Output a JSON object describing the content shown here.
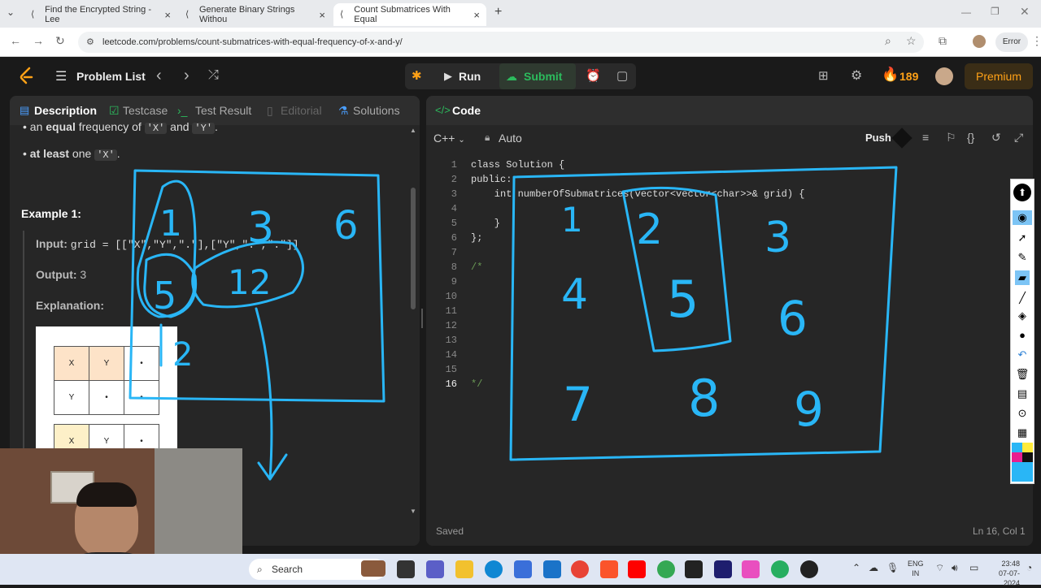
{
  "browser": {
    "tabs": [
      {
        "title": "Find the Encrypted String - Lee"
      },
      {
        "title": "Generate Binary Strings Withou"
      },
      {
        "title": "Count Submatrices With Equal"
      }
    ],
    "url": "leetcode.com/problems/count-submatrices-with-equal-frequency-of-x-and-y/",
    "error_label": "Error"
  },
  "nav": {
    "problem_list": "Problem List",
    "run": "Run",
    "submit": "Submit",
    "streak": "189",
    "premium": "Premium"
  },
  "left": {
    "tabs": [
      "Description",
      "Testcase",
      "Test Result",
      "Editorial",
      "Solutions"
    ],
    "line1_pre": "an ",
    "line1_bold": "equal",
    "line1_post": " frequency of ",
    "line1_x": "'X'",
    "line1_and": " and ",
    "line1_y": "'Y'",
    "line1_end": ".",
    "line2_bold": "at least",
    "line2_post": " one ",
    "line2_x": "'X'",
    "line2_end": ".",
    "example_title": "Example 1:",
    "input_label": "Input:",
    "input_value": "grid = [[\"X\",\"Y\",\".\"],[\"Y\",\".\",\".\"]]",
    "output_label": "Output:",
    "output_value": "3",
    "explanation_label": "Explanation:",
    "grid1": [
      [
        "X",
        "Y",
        "•"
      ],
      [
        "Y",
        "•",
        "•"
      ]
    ],
    "grid2": [
      [
        "X",
        "Y",
        "•"
      ]
    ]
  },
  "right": {
    "title": "Code",
    "language": "C++",
    "mode": "Auto",
    "push": "Push",
    "status": "Saved",
    "cursor": "Ln 16, Col 1",
    "lines": [
      {
        "n": "1",
        "t": "class Solution {"
      },
      {
        "n": "2",
        "t": "public:"
      },
      {
        "n": "3",
        "t": "    int numberOfSubmatrices(vector<vector<char>>& grid) {"
      },
      {
        "n": "4",
        "t": ""
      },
      {
        "n": "5",
        "t": "    }"
      },
      {
        "n": "6",
        "t": "};"
      },
      {
        "n": "7",
        "t": ""
      },
      {
        "n": "8",
        "t": "/*"
      },
      {
        "n": "9",
        "t": ""
      },
      {
        "n": "10",
        "t": ""
      },
      {
        "n": "11",
        "t": ""
      },
      {
        "n": "12",
        "t": ""
      },
      {
        "n": "13",
        "t": ""
      },
      {
        "n": "14",
        "t": ""
      },
      {
        "n": "15",
        "t": ""
      },
      {
        "n": "16",
        "t": "*/"
      }
    ]
  },
  "annotations": {
    "left_numbers": [
      "1",
      "3",
      "6",
      "5",
      "12",
      "2"
    ],
    "right_numbers": [
      "1",
      "2",
      "3",
      "4",
      "5",
      "6",
      "7",
      "8",
      "9"
    ]
  },
  "taskbar": {
    "search": "Search",
    "lang1": "ENG",
    "lang2": "IN",
    "time": "23:48",
    "date": "07-07-2024"
  },
  "colors": {
    "ink": "#29b6f6",
    "accent_orange": "#ffa116",
    "submit_green": "#2cbb5d"
  }
}
